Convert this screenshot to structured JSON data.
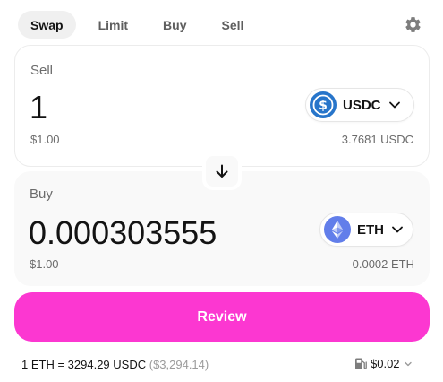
{
  "tabs": [
    {
      "label": "Swap",
      "active": true
    },
    {
      "label": "Limit",
      "active": false
    },
    {
      "label": "Buy",
      "active": false
    },
    {
      "label": "Sell",
      "active": false
    }
  ],
  "icons": {
    "settings": "gear-icon",
    "switch": "arrow-down-icon",
    "chevron": "chevron-down-icon",
    "gas": "gas-pump-icon"
  },
  "sell": {
    "label": "Sell",
    "amount": "1",
    "usd_value": "$1.00",
    "token": {
      "symbol": "USDC",
      "color": "#2775ca"
    },
    "balance": "3.7681 USDC"
  },
  "buy": {
    "label": "Buy",
    "amount": "0.000303555",
    "usd_value": "$1.00",
    "token": {
      "symbol": "ETH",
      "color": "#627eea"
    },
    "balance": "0.0002 ETH"
  },
  "review_button": {
    "label": "Review",
    "color": "#fc37d1"
  },
  "rate": {
    "text": "1 ETH = 3294.29 USDC",
    "usd": "($3,294.14)"
  },
  "gas": {
    "label": "$0.02"
  }
}
